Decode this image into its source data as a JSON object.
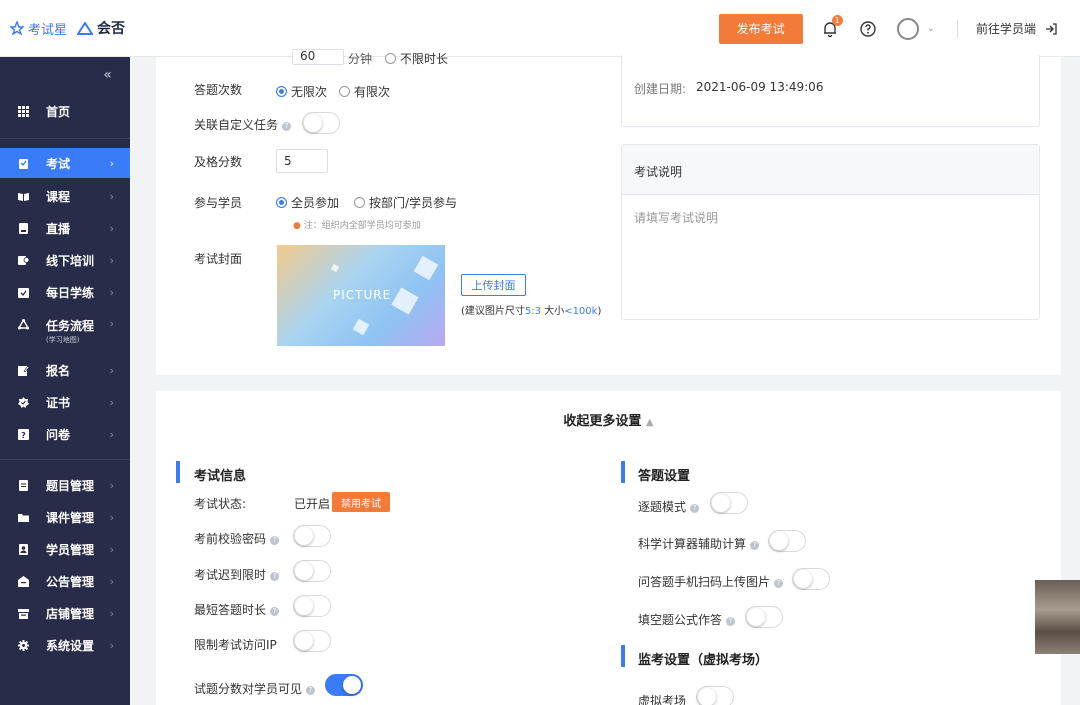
{
  "header": {
    "logo_exam": "考试星",
    "logo_brand": "会否",
    "publish_label": "发布考试",
    "notification_count": "1",
    "student_link": "前往学员端"
  },
  "sidebar": {
    "collapse": "«",
    "items": [
      {
        "label": "首页",
        "icon": "grid-icon"
      },
      {
        "label": "考试",
        "icon": "exam-icon",
        "active": true
      },
      {
        "label": "课程",
        "icon": "book-icon"
      },
      {
        "label": "直播",
        "icon": "live-icon"
      },
      {
        "label": "线下培训",
        "icon": "training-icon"
      },
      {
        "label": "每日学练",
        "icon": "daily-icon"
      },
      {
        "label": "任务流程",
        "sub": "(学习地图)",
        "icon": "flow-icon"
      },
      {
        "label": "报名",
        "icon": "signup-icon"
      },
      {
        "label": "证书",
        "icon": "certificate-icon"
      },
      {
        "label": "问卷",
        "icon": "survey-icon"
      },
      {
        "label": "题目管理",
        "icon": "question-icon"
      },
      {
        "label": "课件管理",
        "icon": "folder-icon"
      },
      {
        "label": "学员管理",
        "icon": "user-icon"
      },
      {
        "label": "公告管理",
        "icon": "notice-icon"
      },
      {
        "label": "店铺管理",
        "icon": "shop-icon"
      },
      {
        "label": "系统设置",
        "icon": "gear-icon"
      }
    ]
  },
  "form": {
    "duration_value": "60",
    "duration_unit": "分钟",
    "no_limit_duration": "不限时长",
    "attempts_label": "答题次数",
    "attempts_unlimited": "无限次",
    "attempts_limited": "有限次",
    "custom_task_label": "关联自定义任务",
    "pass_score_label": "及格分数",
    "pass_score_value": "5",
    "participants_label": "参与学员",
    "participants_all": "全员参加",
    "participants_dept": "按部门/学员参与",
    "participants_note": "注：组织内全部学员均可参加",
    "cover_label": "考试封面",
    "cover_text": "PICTURE",
    "upload_label": "上传封面",
    "hint_prefix": "(建议图片尺寸",
    "hint_ratio": "5:3",
    "hint_mid": " 大小",
    "hint_size": "<100k",
    "hint_suffix": ")"
  },
  "info": {
    "created_label": "创建日期:",
    "created_value": "2021-06-09 13:49:06",
    "desc_title": "考试说明",
    "desc_placeholder": "请填写考试说明"
  },
  "more": {
    "toggle_label": "收起更多设置",
    "exam_info_title": "考试信息",
    "status_label": "考试状态:",
    "status_value": "已开启",
    "disable_btn": "禁用考试",
    "password_label": "考前校验密码",
    "late_label": "考试迟到限时",
    "min_time_label": "最短答题时长",
    "ip_label": "限制考试访问IP",
    "score_visible_label": "试题分数对学员可见",
    "answer_title": "答题设置",
    "one_by_one_label": "逐题模式",
    "calculator_label": "科学计算器辅助计算",
    "mobile_upload_label": "问答题手机扫码上传图片",
    "formula_label": "填空题公式作答",
    "monitor_title": "监考设置（虚拟考场）",
    "virtual_room_label": "虚拟考场"
  },
  "colors": {
    "accent": "#3a7bf7",
    "orange": "#f37b3a",
    "sidebar_bg": "#272c49"
  }
}
